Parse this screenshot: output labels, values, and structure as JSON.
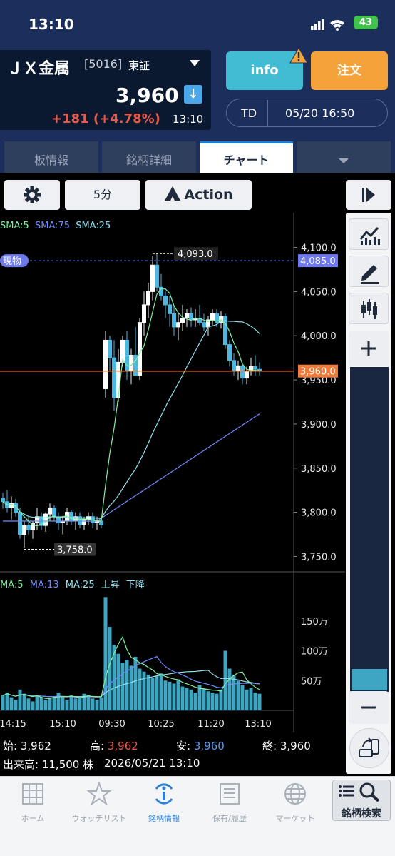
{
  "status_bar": {
    "time": "13:10",
    "battery": "43"
  },
  "stock": {
    "name": "ＪＸ金属",
    "code": "[5016]",
    "market": "東証",
    "price": "3,960",
    "change": "+181 (+4.78%)",
    "time": "13:10"
  },
  "actions": {
    "info": "info",
    "order": "注文",
    "td_label": "TD",
    "td_datetime": "05/20 16:50"
  },
  "tabs": [
    {
      "label": "板情報",
      "active": false
    },
    {
      "label": "銘柄詳細",
      "active": false
    },
    {
      "label": "チャート",
      "active": true
    },
    {
      "label": "",
      "active": false
    }
  ],
  "toolbar": {
    "interval": "5分",
    "action": "Action"
  },
  "chart_data": {
    "type": "candlestick",
    "price_indicators": [
      {
        "name": "SMA:5",
        "color": "#7ff0a0"
      },
      {
        "name": "SMA:75",
        "color": "#6f8cff"
      },
      {
        "name": "SMA:25",
        "color": "#8fe0f0"
      }
    ],
    "price_axis_ticks": [
      "4,100.0",
      "4,050.0",
      "4,000.0",
      "3,950.0",
      "3,900.0",
      "3,850.0",
      "3,800.0",
      "3,750.0"
    ],
    "y_range": [
      3735,
      4115
    ],
    "label_genbutsu": "現物",
    "genbutsu_price": "4,085.0",
    "current_price": "3,960.0",
    "high_label": "4,093.0",
    "low_label": "3,758.0",
    "volume_indicators": [
      {
        "name": "MA:5",
        "color": "#7ff0a0"
      },
      {
        "name": "MA:13",
        "color": "#6f8cff"
      },
      {
        "name": "MA:25",
        "color": "#8fe0f0"
      },
      {
        "name": "上昇",
        "color": "#8fe0f0"
      },
      {
        "name": "下降",
        "color": "#8fe0f0"
      }
    ],
    "volume_axis_ticks": [
      "150万",
      "100万",
      "50万"
    ],
    "x_ticks": [
      "14:15",
      "15:10",
      "09:30",
      "10:25",
      "11:20",
      "13:10"
    ],
    "candles": [
      [
        3816,
        3822,
        3804,
        3812
      ],
      [
        3812,
        3825,
        3800,
        3805
      ],
      [
        3805,
        3818,
        3792,
        3810
      ],
      [
        3810,
        3815,
        3795,
        3800
      ],
      [
        3800,
        3805,
        3770,
        3775
      ],
      [
        3775,
        3790,
        3760,
        3785
      ],
      [
        3785,
        3795,
        3775,
        3780
      ],
      [
        3780,
        3790,
        3770,
        3788
      ],
      [
        3788,
        3805,
        3780,
        3795
      ],
      [
        3795,
        3800,
        3780,
        3785
      ],
      [
        3785,
        3800,
        3778,
        3798
      ],
      [
        3798,
        3810,
        3790,
        3805
      ],
      [
        3805,
        3808,
        3790,
        3795
      ],
      [
        3795,
        3800,
        3780,
        3788
      ],
      [
        3788,
        3795,
        3775,
        3790
      ],
      [
        3790,
        3805,
        3785,
        3800
      ],
      [
        3800,
        3802,
        3785,
        3790
      ],
      [
        3790,
        3800,
        3780,
        3795
      ],
      [
        3795,
        3800,
        3782,
        3786
      ],
      [
        3786,
        3795,
        3780,
        3792
      ],
      [
        3792,
        3800,
        3785,
        3795
      ],
      [
        3795,
        3800,
        3782,
        3788
      ],
      [
        3788,
        3795,
        3780,
        3790
      ],
      [
        3790,
        3792,
        3782,
        3786
      ],
      [
        3940,
        4005,
        3930,
        3995
      ],
      [
        3995,
        4000,
        3960,
        3975
      ],
      [
        3975,
        3995,
        3915,
        3930
      ],
      [
        3930,
        3985,
        3925,
        3970
      ],
      [
        3970,
        4000,
        3965,
        3995
      ],
      [
        3995,
        4005,
        3950,
        3960
      ],
      [
        3960,
        3985,
        3945,
        3978
      ],
      [
        3978,
        4010,
        3970,
        3955
      ],
      [
        3955,
        4020,
        3950,
        4015
      ],
      [
        4015,
        4050,
        4000,
        4035
      ],
      [
        4035,
        4060,
        4020,
        4050
      ],
      [
        4050,
        4090,
        4040,
        4080
      ],
      [
        4080,
        4093,
        4050,
        4055
      ],
      [
        4055,
        4070,
        4040,
        4045
      ],
      [
        4045,
        4050,
        4020,
        4035
      ],
      [
        4035,
        4045,
        4010,
        4025
      ],
      [
        4025,
        4035,
        4000,
        4010
      ],
      [
        4010,
        4025,
        3995,
        4015
      ],
      [
        4015,
        4035,
        4005,
        4020
      ],
      [
        4020,
        4030,
        4010,
        4025
      ],
      [
        4025,
        4032,
        4010,
        4018
      ],
      [
        4018,
        4030,
        4010,
        4020
      ],
      [
        4020,
        4035,
        4012,
        4015
      ],
      [
        4015,
        4025,
        4005,
        4010
      ],
      [
        4010,
        4022,
        4000,
        4018
      ],
      [
        4018,
        4030,
        4012,
        4025
      ],
      [
        4025,
        4030,
        4010,
        4015
      ],
      [
        4015,
        4028,
        4008,
        4022
      ],
      [
        4022,
        4025,
        3985,
        3990
      ],
      [
        3990,
        3995,
        3965,
        3972
      ],
      [
        3972,
        3980,
        3955,
        3960
      ],
      [
        3960,
        3972,
        3950,
        3966
      ],
      [
        3966,
        3970,
        3945,
        3952
      ],
      [
        3952,
        3965,
        3945,
        3960
      ],
      [
        3960,
        3975,
        3955,
        3965
      ],
      [
        3965,
        3978,
        3955,
        3962
      ],
      [
        3962,
        3970,
        3955,
        3960
      ]
    ],
    "volumes": [
      25,
      30,
      22,
      18,
      35,
      28,
      20,
      15,
      25,
      22,
      18,
      20,
      24,
      30,
      22,
      18,
      25,
      20,
      22,
      28,
      26,
      20,
      18,
      22,
      190,
      140,
      110,
      95,
      80,
      85,
      75,
      90,
      70,
      65,
      60,
      55,
      58,
      62,
      50,
      48,
      45,
      52,
      40,
      38,
      35,
      30,
      42,
      36,
      32,
      30,
      28,
      35,
      100,
      70,
      60,
      50,
      42,
      35,
      38,
      30,
      28
    ],
    "sma5_volume_peak": "150万"
  },
  "footer": {
    "open_label": "始:",
    "open": "3,962",
    "high_label": "高:",
    "high": "3,962",
    "low_label": "安:",
    "low": "3,960",
    "close_label": "終:",
    "close": "3,960",
    "volume_label": "出来高:",
    "volume": "11,500 株",
    "datetime": "2026/05/21 13:10"
  },
  "nav": [
    {
      "label": "ホーム",
      "icon": "home-icon"
    },
    {
      "label": "ウォッチリスト",
      "icon": "star-icon"
    },
    {
      "label": "銘柄情報",
      "icon": "info-icon",
      "active": true
    },
    {
      "label": "保有/履歴",
      "icon": "list-icon"
    },
    {
      "label": "マーケット",
      "icon": "globe-icon"
    },
    {
      "label": "銘柄検索",
      "icon": "search-icon"
    }
  ]
}
